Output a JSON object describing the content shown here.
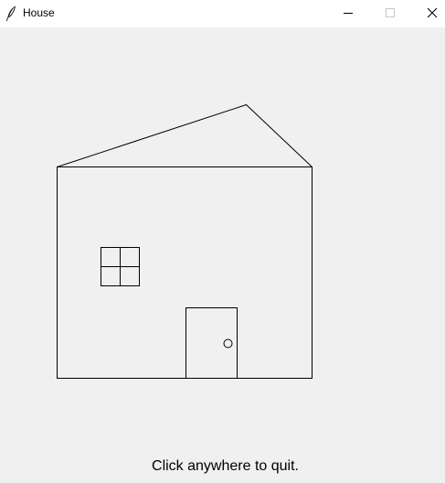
{
  "window": {
    "title": "House",
    "icon": "feather-icon"
  },
  "controls": {
    "minimize_icon": "minimize-icon",
    "maximize_icon": "maximize-icon",
    "close_icon": "close-icon"
  },
  "canvas": {
    "message": "Click anywhere to quit."
  },
  "colors": {
    "background": "#f0f0f0",
    "titlebar": "#ffffff",
    "stroke": "#000000"
  }
}
